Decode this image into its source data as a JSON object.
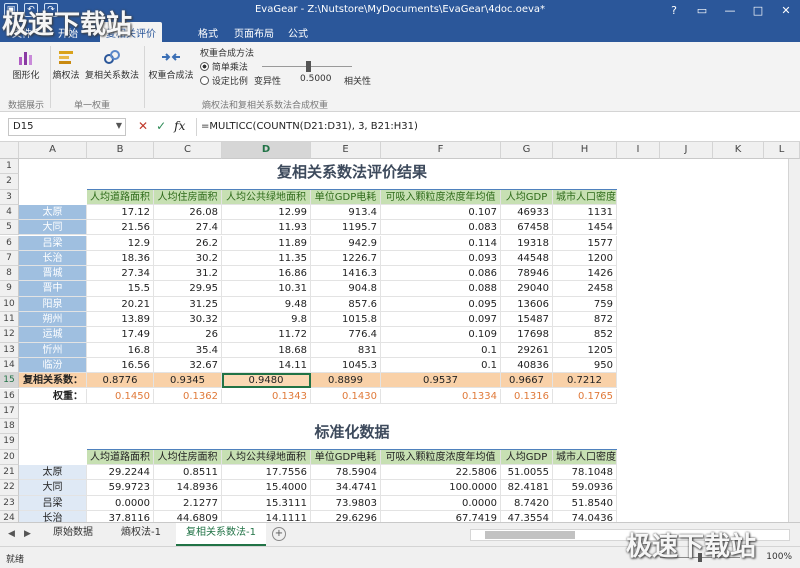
{
  "app": {
    "title": "EvaGear - Z:\\Nutstore\\MyDocuments\\EvaGear\\4doc.oeva*"
  },
  "menu": [
    {
      "label": "文件"
    },
    {
      "label": "开始"
    },
    {
      "label": "复相关评价"
    },
    {
      "label": "格式"
    },
    {
      "label": "页面布局"
    },
    {
      "label": "公式"
    }
  ],
  "ribbon": {
    "chart_btn": "图形化",
    "entropy_btn": "熵权法",
    "corr_btn": "复相关系数法",
    "combine_btn": "权重合成法",
    "method_label": "权重合成方法",
    "radio_simple": "简单乘法",
    "radio_custom": "设定比例",
    "variability": "变异性",
    "ratio_value": "0.5000",
    "correlation": "相关性",
    "group1": "数据展示",
    "group2": "单一权重",
    "group3": "熵权法和复相关系数法合成权重"
  },
  "formula_bar": {
    "name_box": "D15",
    "formula": "=MULTICC(COUNTN(D21:D31), 3, B21:H31)"
  },
  "sheet": {
    "columns": [
      "A",
      "B",
      "C",
      "D",
      "E",
      "F",
      "G",
      "H",
      "I",
      "J",
      "K",
      "L"
    ],
    "rows": [
      "1",
      "2",
      "3",
      "4",
      "5",
      "6",
      "7",
      "8",
      "9",
      "10",
      "11",
      "12",
      "13",
      "14",
      "15",
      "16",
      "17",
      "18",
      "19",
      "20",
      "21",
      "22",
      "23",
      "24",
      "25"
    ],
    "title1": "复相关系数法评价结果",
    "title2": "标准化数据",
    "headers": [
      "人均道路面积",
      "人均住房面积",
      "人均公共绿地面积",
      "单位GDP电耗",
      "可吸入颗粒度浓度年均值",
      "人均GDP",
      "城市人口密度"
    ],
    "cities": [
      "太原",
      "大同",
      "吕梁",
      "长治",
      "晋城",
      "晋中",
      "阳泉",
      "朔州",
      "运城",
      "忻州",
      "临汾"
    ],
    "data": [
      [
        "17.12",
        "26.08",
        "12.99",
        "913.4",
        "0.107",
        "46933",
        "1131"
      ],
      [
        "21.56",
        "27.4",
        "11.93",
        "1195.7",
        "0.083",
        "67458",
        "1454"
      ],
      [
        "12.9",
        "26.2",
        "11.89",
        "942.9",
        "0.114",
        "19318",
        "1577"
      ],
      [
        "18.36",
        "30.2",
        "11.35",
        "1226.7",
        "0.093",
        "44548",
        "1200"
      ],
      [
        "27.34",
        "31.2",
        "16.86",
        "1416.3",
        "0.086",
        "78946",
        "1426"
      ],
      [
        "15.5",
        "29.95",
        "10.31",
        "904.8",
        "0.088",
        "29040",
        "2458"
      ],
      [
        "20.21",
        "31.25",
        "9.48",
        "857.6",
        "0.095",
        "13606",
        "759"
      ],
      [
        "13.89",
        "30.32",
        "9.8",
        "1015.8",
        "0.097",
        "15487",
        "872"
      ],
      [
        "17.49",
        "26",
        "11.72",
        "776.4",
        "0.109",
        "17698",
        "852"
      ],
      [
        "16.8",
        "35.4",
        "18.68",
        "831",
        "0.1",
        "29261",
        "1205"
      ],
      [
        "16.56",
        "32.67",
        "14.11",
        "1045.3",
        "0.1",
        "40836",
        "950"
      ]
    ],
    "corr_label": "复相关系数：",
    "corr": [
      "0.8776",
      "0.9345",
      "0.9480",
      "0.8899",
      "0.9537",
      "0.9667",
      "0.7212"
    ],
    "weight_label": "权重：",
    "weight": [
      "0.1450",
      "0.1362",
      "0.1343",
      "0.1430",
      "0.1334",
      "0.1316",
      "0.1765"
    ],
    "std_cities": [
      "太原",
      "大同",
      "吕梁",
      "长治"
    ],
    "std_data": [
      [
        "29.2244",
        "0.8511",
        "17.7556",
        "78.5904",
        "22.5806",
        "51.0055",
        "78.1048"
      ],
      [
        "59.9723",
        "14.8936",
        "15.4000",
        "34.4741",
        "100.0000",
        "82.4181",
        "59.0936"
      ],
      [
        "0.0000",
        "2.1277",
        "15.3111",
        "73.9803",
        "0.0000",
        "8.7420",
        "51.8540"
      ],
      [
        "37.8116",
        "44.6809",
        "14.1111",
        "29.6296",
        "67.7419",
        "47.3554",
        "74.0436"
      ]
    ]
  },
  "sheet_tabs": [
    "原始数据",
    "熵权法-1",
    "复相关系数法-1"
  ],
  "status": {
    "ready": "就绪",
    "zoom": "100%"
  },
  "watermark": "极速下载站",
  "colors": {
    "accent": "#2b579a",
    "header_band": "#c7e0b3",
    "city_blue": "#9fbfe0",
    "orange_row": "#f9d1a8"
  }
}
